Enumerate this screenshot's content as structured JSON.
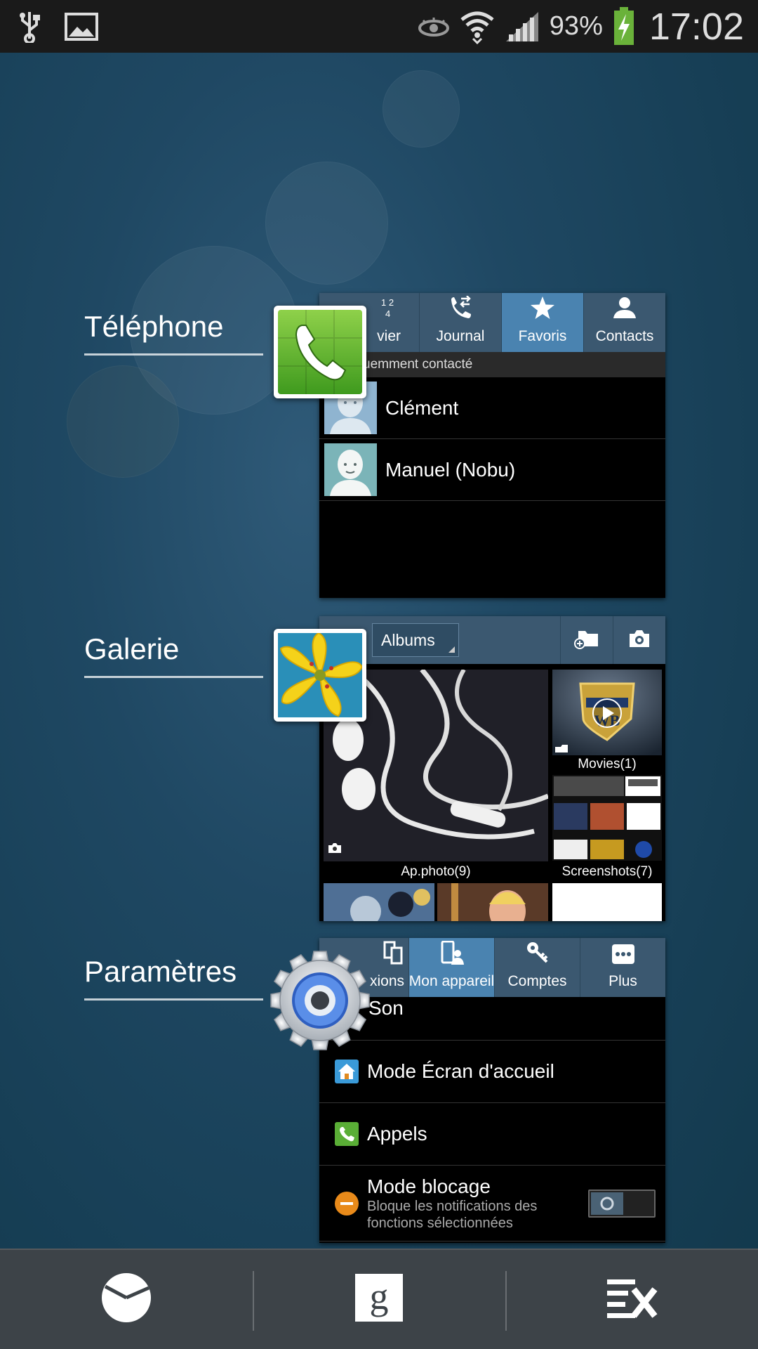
{
  "status_bar": {
    "battery": "93%",
    "time": "17:02"
  },
  "sections": {
    "telephone": {
      "label": "Téléphone",
      "tabs": [
        {
          "label": "Clavier",
          "visible": "vier",
          "icon": "keypad-icon"
        },
        {
          "label": "Journal",
          "icon": "call-log-icon"
        },
        {
          "label": "Favoris",
          "icon": "star-icon",
          "active": true
        },
        {
          "label": "Contacts",
          "icon": "person-icon"
        }
      ],
      "subheader": "uemment contacté",
      "contacts": [
        {
          "name": "Clément"
        },
        {
          "name": "Manuel (Nobu)"
        }
      ]
    },
    "gallery": {
      "label": "Galerie",
      "dropdown": "Albums",
      "albums": [
        {
          "caption": "Ap.photo(9)"
        },
        {
          "caption": "Movies(1)"
        },
        {
          "caption": "Screenshots(7)"
        }
      ]
    },
    "settings": {
      "label": "Paramètres",
      "tabs": [
        {
          "label": "Connexions",
          "visible": "xions",
          "icon": "connections-icon"
        },
        {
          "label": "Mon appareil",
          "icon": "device-icon",
          "active": true
        },
        {
          "label": "Comptes",
          "icon": "key-icon"
        },
        {
          "label": "Plus",
          "icon": "more-icon"
        }
      ],
      "rows": [
        {
          "label": "Son"
        },
        {
          "label": "Mode Écran d'accueil",
          "icon": "home-icon"
        },
        {
          "label": "Appels",
          "icon": "phone-icon"
        },
        {
          "label": "Mode blocage",
          "sub": "Bloque les notifications des fonctions sélectionnées",
          "icon": "block-icon",
          "toggle": false
        }
      ]
    }
  },
  "colors": {
    "tab_bg": "#3b5870",
    "tab_active": "#4a83b0",
    "bottom_bar": "#3d4348"
  }
}
